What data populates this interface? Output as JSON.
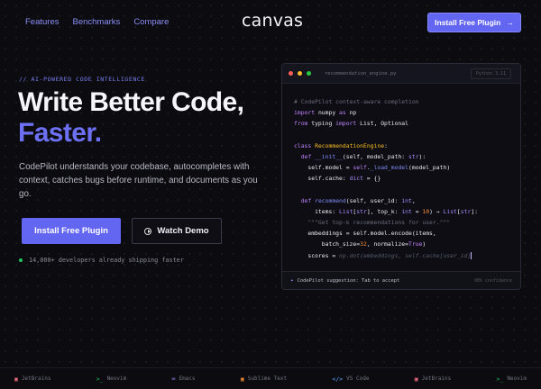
{
  "nav": {
    "links": [
      "Features",
      "Benchmarks",
      "Compare"
    ],
    "logo": "canvas",
    "cta": "Install Free Plugin",
    "cta_arrow": "→"
  },
  "hero": {
    "eyebrow": "// AI-POWERED CODE INTELLIGENCE",
    "title_line1": "Write Better Code,",
    "title_line2": "Faster.",
    "lead": "CodePilot understands your codebase, autocompletes with context, catches bugs before runtime, and documents as you go.",
    "primary_cta": "Install Free Plugin",
    "secondary_cta": "Watch Demo",
    "social_proof": "14,000+ developers already shipping faster"
  },
  "editor": {
    "filename": "recommendation_engine.py",
    "language": "Python 3.11",
    "suggestion_label": "CodePilot suggestion: Tab to accept",
    "confidence": "98% confidence"
  },
  "footer": {
    "items": [
      {
        "icon": "jetbrains-icon",
        "glyph": "▣",
        "label": "JetBrains"
      },
      {
        "icon": "neovim-icon",
        "glyph": ">_",
        "label": "Neovim"
      },
      {
        "icon": "emacs-icon",
        "glyph": "⌨",
        "label": "Emacs"
      },
      {
        "icon": "sublime-icon",
        "glyph": "▣",
        "label": "Sublime Text"
      },
      {
        "icon": "vscode-icon",
        "glyph": "</>",
        "label": "VS Code"
      },
      {
        "icon": "jetbrains-icon",
        "glyph": "▣",
        "label": "JetBrains"
      },
      {
        "icon": "neovim-icon",
        "glyph": ">_",
        "label": "Neovim"
      }
    ]
  },
  "colors": {
    "accent": "#6366f1",
    "background": "#0b0b10",
    "green": "#22c55e"
  }
}
